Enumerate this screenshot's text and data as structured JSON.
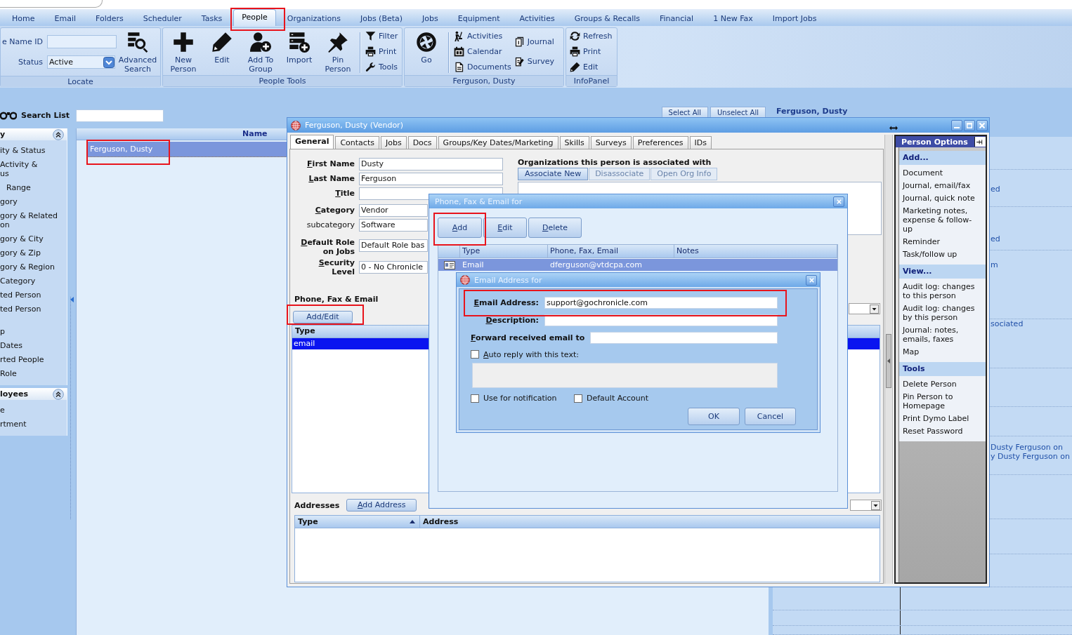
{
  "tabs": [
    {
      "label": "Home",
      "selected": false
    },
    {
      "label": "Email",
      "selected": false
    },
    {
      "label": "Folders",
      "selected": false
    },
    {
      "label": "Scheduler",
      "selected": false
    },
    {
      "label": "Tasks",
      "selected": false
    },
    {
      "label": "People",
      "selected": true
    },
    {
      "label": "Organizations",
      "selected": false
    },
    {
      "label": "Jobs (Beta)",
      "selected": false
    },
    {
      "label": "Jobs",
      "selected": false
    },
    {
      "label": "Equipment",
      "selected": false
    },
    {
      "label": "Activities",
      "selected": false
    },
    {
      "label": "Groups & Recalls",
      "selected": false
    },
    {
      "label": "Financial",
      "selected": false
    },
    {
      "label": "1 New Fax",
      "selected": false
    },
    {
      "label": "Import Jobs",
      "selected": false
    }
  ],
  "ribbon": {
    "locate": {
      "label": "Locate",
      "name_id_label": "e Name ID",
      "status_label": "Status",
      "status_value": "Active",
      "advanced_search": "Advanced Search"
    },
    "people_tools": {
      "label": "People Tools",
      "large_buttons": [
        "New Person",
        "Edit",
        "Add To Group",
        "Import",
        "Pin Person"
      ],
      "small_buttons": [
        "Filter",
        "Print",
        "Tools"
      ]
    },
    "person": {
      "label": "Ferguson, Dusty",
      "go": "Go",
      "links": [
        "Activities",
        "Calendar",
        "Documents"
      ],
      "more_links": [
        "Journal",
        "Survey"
      ]
    },
    "info_panel": {
      "label": "InfoPanel",
      "buttons": [
        "Refresh",
        "Print",
        "Edit"
      ]
    }
  },
  "search_list": {
    "label": "Search List",
    "buttons": [
      "Select All",
      "Unselect All"
    ]
  },
  "sidebar": {
    "panels": [
      {
        "title": "y",
        "expanded": true,
        "items": [
          "ity & Status",
          "Activity &\nus",
          "Range",
          "gory",
          "gory & Related\non",
          "gory & City",
          "gory & Zip",
          "gory & Region",
          "Category",
          "ted Person",
          "ted Person",
          "p",
          "Dates",
          "rted People",
          "Role"
        ]
      },
      {
        "title": "loyees",
        "expanded": true,
        "items": [
          "e",
          "rtment"
        ]
      }
    ]
  },
  "list": {
    "column": "Name",
    "rows": [
      {
        "name": "Ferguson, Dusty",
        "selected": true
      }
    ]
  },
  "info_view": {
    "title": "Ferguson, Dusty",
    "texts": [
      "ed",
      "ed",
      "m",
      "sociated",
      "Dusty Ferguson on",
      "y Dusty Ferguson on"
    ]
  },
  "main_window": {
    "title": "Ferguson, Dusty (Vendor)",
    "tabs": [
      {
        "label": "General",
        "selected": true
      },
      {
        "label": "Contacts",
        "selected": false
      },
      {
        "label": "Jobs",
        "selected": false
      },
      {
        "label": "Docs",
        "selected": false
      },
      {
        "label": "Groups/Key Dates/Marketing",
        "selected": false
      },
      {
        "label": "Skills",
        "selected": false
      },
      {
        "label": "Surveys",
        "selected": false
      },
      {
        "label": "Preferences",
        "selected": false
      },
      {
        "label": "IDs",
        "selected": false
      }
    ],
    "fields": [
      {
        "label": "First Name",
        "value": "Dusty",
        "access_key": true
      },
      {
        "label": "Last Name",
        "value": "Ferguson",
        "access_key": true
      },
      {
        "label": "Title",
        "access_key": true
      },
      {
        "label": "Category",
        "value": "Vendor",
        "access_key": true
      },
      {
        "label": "subcategory",
        "value": "Software",
        "access_key": false
      },
      {
        "label": "Default Role on Jobs",
        "value": "Default Role bas",
        "access_key": true
      },
      {
        "label": "Security Level",
        "value": "0 - No Chronicle",
        "access_key": true
      }
    ],
    "organizations": {
      "title": "Organizations this person is associated with",
      "buttons": [
        {
          "label": "Associate New",
          "disabled": false
        },
        {
          "label": "Disassociate",
          "disabled": true
        },
        {
          "label": "Open Org Info",
          "disabled": true
        }
      ]
    },
    "contact_methods": {
      "label": "Phone, Fax & Email",
      "button": "Add/Edit",
      "columns": [
        "Type"
      ],
      "rows": [
        {
          "type": "email",
          "selected": true
        }
      ]
    },
    "addresses": {
      "label": "Addresses",
      "button": {
        "label": "Add Address",
        "access_key": true
      },
      "columns": [
        {
          "label": "Type",
          "sorted": true
        },
        {
          "label": "Address",
          "sorted": false
        }
      ]
    },
    "person_options": {
      "title": "Person Options",
      "sections": [
        {
          "title": "Add...",
          "items": [
            "Document",
            "Journal, email/fax",
            "Journal, quick note",
            "Marketing notes, expense & follow-up",
            "Reminder",
            "Task/follow up"
          ]
        },
        {
          "title": "View...",
          "items": [
            "Audit log: changes to this person",
            "Audit log: changes by this person",
            "Journal: notes, emails, faxes",
            "Map"
          ]
        },
        {
          "title": "Tools",
          "items": [
            "Delete Person",
            "Pin Person to Homepage",
            "Print Dymo Label",
            "Reset Password"
          ]
        }
      ]
    }
  },
  "phone_dialog": {
    "title": "Phone, Fax & Email for",
    "buttons": [
      {
        "label": "Add",
        "access_key": true
      },
      {
        "label": "Edit",
        "access_key": true
      },
      {
        "label": "Delete",
        "access_key": true
      }
    ],
    "columns": [
      "Type",
      "Phone, Fax, Email",
      "Notes"
    ],
    "rows": [
      {
        "type": "Email",
        "value": "dferguson@vtdcpa.com",
        "selected": true
      }
    ]
  },
  "email_dialog": {
    "title": "Email Address for",
    "fields": [
      {
        "label": "Email Address:",
        "value": "support@gochronicle.com",
        "access_key": true
      },
      {
        "label": "Description:",
        "access_key": true
      },
      {
        "label": "Forward received email to",
        "access_key": true
      }
    ],
    "auto_reply": {
      "label": "Auto reply with this text:",
      "checked": false,
      "access_key": true
    },
    "options": [
      {
        "label": "Use for notification",
        "checked": false
      },
      {
        "label": "Default Account",
        "checked": false
      }
    ],
    "buttons": [
      "OK",
      "Cancel"
    ]
  }
}
